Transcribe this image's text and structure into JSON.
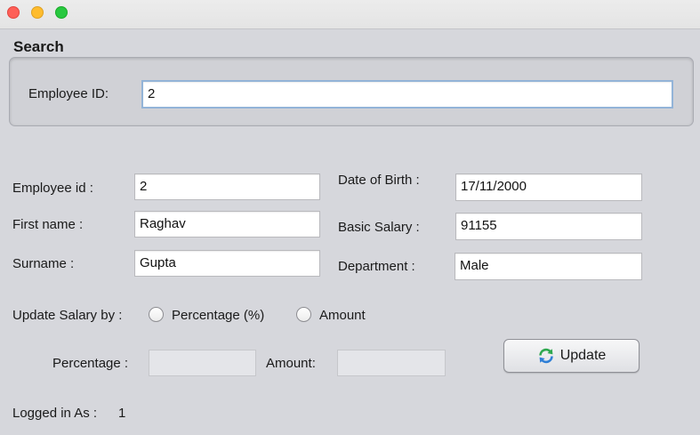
{
  "search": {
    "title": "Search",
    "employee_id_label": "Employee ID:",
    "employee_id_value": "2"
  },
  "form": {
    "employee_id_label": "Employee id :",
    "employee_id_value": "2",
    "first_name_label": "First name :",
    "first_name_value": "Raghav",
    "surname_label": "Surname :",
    "surname_value": "Gupta",
    "dob_label": "Date of Birth :",
    "dob_value": "17/11/2000",
    "basic_salary_label": "Basic Salary :",
    "basic_salary_value": "91155",
    "department_label": "Department :",
    "department_value": "Male"
  },
  "update_salary": {
    "label": "Update Salary by :",
    "option_percentage": "Percentage (%)",
    "option_amount": "Amount",
    "percentage_label": "Percentage :",
    "percentage_value": "",
    "amount_label": "Amount:",
    "amount_value": ""
  },
  "actions": {
    "update_label": "Update",
    "update_icon": "refresh-icon"
  },
  "status": {
    "logged_in_label": "Logged in As :",
    "logged_in_value": "1"
  },
  "colors": {
    "window_bg": "#d6d7dc",
    "focus_ring": "#93b4d8",
    "close": "#fe5f57",
    "minimize": "#febc2e",
    "maximize": "#28c840",
    "refresh_green": "#2fa84f",
    "refresh_blue": "#2f7fd6"
  }
}
